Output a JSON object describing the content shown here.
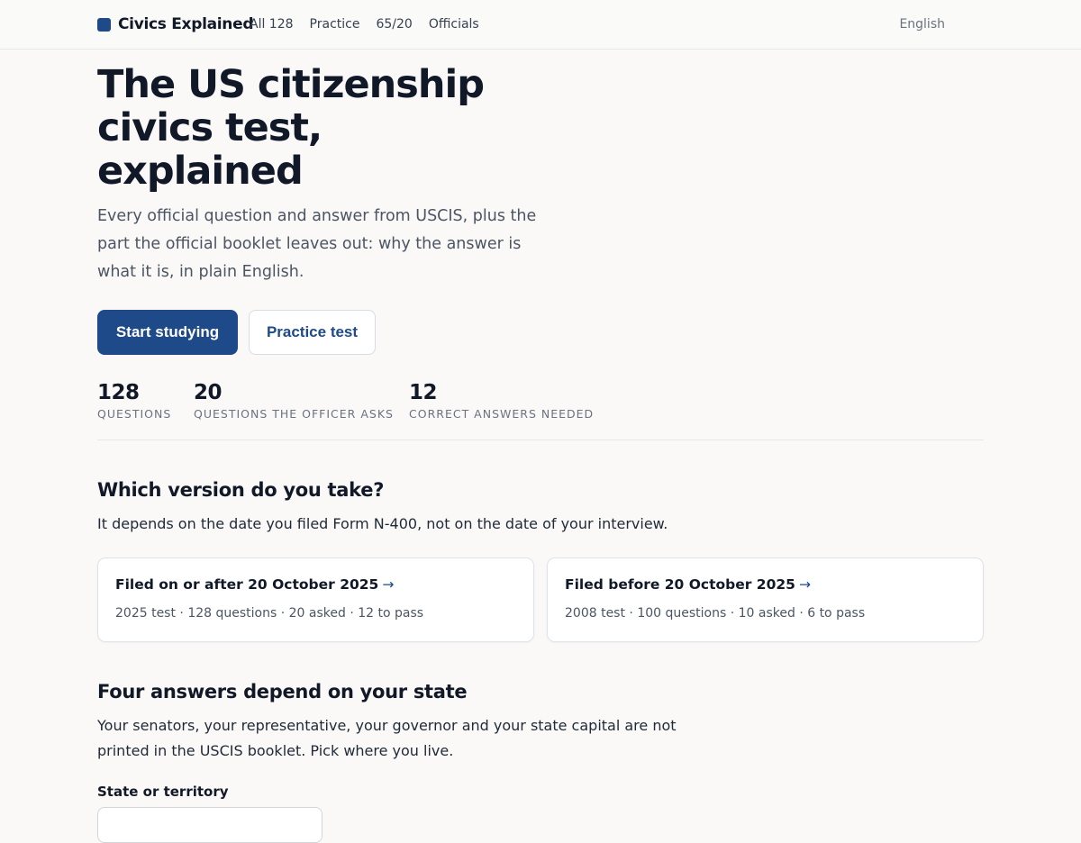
{
  "header": {
    "brand": "Civics Explained",
    "nav": [
      "All 128",
      "Practice",
      "65/20",
      "Officials"
    ],
    "language": "English"
  },
  "hero": {
    "title_lines": [
      "The US citizenship",
      "civics test,",
      "explained"
    ],
    "subtitle_lines": [
      "Every official question and answer from USCIS, plus the",
      "part the official booklet leaves out: why the answer is",
      "what it is, in plain English."
    ],
    "primary_button": "Start studying",
    "secondary_button": "Practice test"
  },
  "stats": [
    {
      "value": "128",
      "label": "Questions"
    },
    {
      "value": "20",
      "label": "Questions the officer asks"
    },
    {
      "value": "12",
      "label": "Correct answers needed"
    }
  ],
  "version_section": {
    "heading": "Which version do you take?",
    "description": "It depends on the date you filed Form N-400, not on the date of your interview.",
    "cards": [
      {
        "title": "Filed on or after 20 October 2025",
        "arrow": "→",
        "meta": "2025 test · 128 questions · 20 asked · 12 to pass"
      },
      {
        "title": "Filed before 20 October 2025",
        "arrow": "→",
        "meta": "2008 test · 100 questions · 10 asked · 6 to pass"
      }
    ]
  },
  "state_section": {
    "heading": "Four answers depend on your state",
    "description_lines": [
      "Your senators, your representative, your governor and your state capital are not",
      "printed in the USCIS booklet. Pick where you live."
    ],
    "field_label": "State or territory"
  },
  "colors": {
    "accent": "#1e4a8a",
    "background": "#faf9f7"
  }
}
